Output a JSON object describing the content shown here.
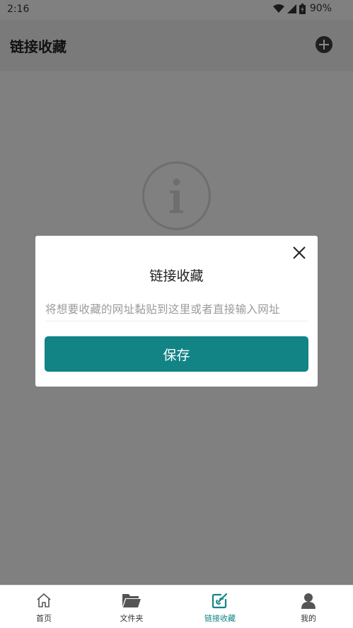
{
  "status_bar": {
    "time": "2:16",
    "battery": "90%"
  },
  "header": {
    "title": "链接收藏",
    "add_icon": "plus-circle-icon"
  },
  "empty_state": {
    "icon": "info-icon"
  },
  "dialog": {
    "title": "链接收藏",
    "input_placeholder": "将想要收藏的网址黏贴到这里或者直接输入网址",
    "input_value": "",
    "save_label": "保存",
    "close_icon": "close-icon"
  },
  "bottom_nav": {
    "items": [
      {
        "label": "首页",
        "icon": "home-icon",
        "active": false
      },
      {
        "label": "文件夹",
        "icon": "folder-icon",
        "active": false
      },
      {
        "label": "链接收藏",
        "icon": "link-edit-icon",
        "active": true
      },
      {
        "label": "我的",
        "icon": "person-icon",
        "active": false
      }
    ]
  },
  "colors": {
    "accent": "#128486",
    "overlay": "#808080"
  }
}
